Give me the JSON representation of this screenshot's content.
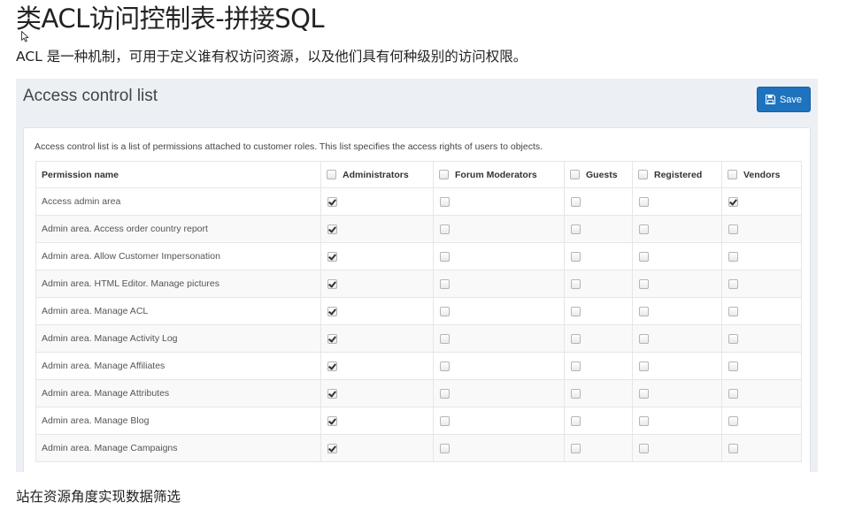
{
  "doc": {
    "title": "类ACL访问控制表-拼接SQL",
    "intro": "ACL 是一种机制，可用于定义谁有权访问资源，以及他们具有何种级别的访问权限。",
    "footer": "站在资源角度实现数据筛选"
  },
  "panel": {
    "heading": "Access control list",
    "save_label": "Save",
    "save_icon": "floppy-disk-icon",
    "description": "Access control list is a list of permissions attached to customer roles. This list specifies the access rights of users to objects.",
    "accent_color": "#1e73be",
    "background_color": "#ecf0f5"
  },
  "table": {
    "permission_header": "Permission name",
    "roles": [
      "Administrators",
      "Forum Moderators",
      "Guests",
      "Registered",
      "Vendors"
    ],
    "rows": [
      {
        "name": "Access admin area",
        "checks": [
          true,
          false,
          false,
          false,
          true
        ]
      },
      {
        "name": "Admin area. Access order country report",
        "checks": [
          true,
          false,
          false,
          false,
          false
        ]
      },
      {
        "name": "Admin area. Allow Customer Impersonation",
        "checks": [
          true,
          false,
          false,
          false,
          false
        ]
      },
      {
        "name": "Admin area. HTML Editor. Manage pictures",
        "checks": [
          true,
          false,
          false,
          false,
          false
        ]
      },
      {
        "name": "Admin area. Manage ACL",
        "checks": [
          true,
          false,
          false,
          false,
          false
        ]
      },
      {
        "name": "Admin area. Manage Activity Log",
        "checks": [
          true,
          false,
          false,
          false,
          false
        ]
      },
      {
        "name": "Admin area. Manage Affiliates",
        "checks": [
          true,
          false,
          false,
          false,
          false
        ]
      },
      {
        "name": "Admin area. Manage Attributes",
        "checks": [
          true,
          false,
          false,
          false,
          false
        ]
      },
      {
        "name": "Admin area. Manage Blog",
        "checks": [
          true,
          false,
          false,
          false,
          false
        ]
      },
      {
        "name": "Admin area. Manage Campaigns",
        "checks": [
          true,
          false,
          false,
          false,
          false
        ]
      }
    ]
  }
}
